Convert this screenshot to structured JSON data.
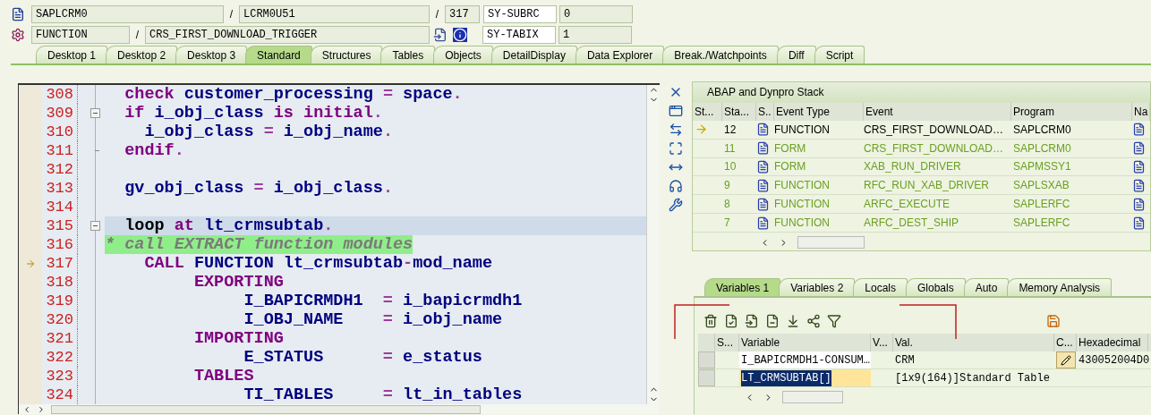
{
  "header": {
    "program": "SAPLCRM0",
    "include": "LCRM0U51",
    "line": "317",
    "event_type": "FUNCTION",
    "event": "CRS_FIRST_DOWNLOAD_TRIGGER",
    "separators": [
      "/",
      "/",
      "/"
    ],
    "system_fields": [
      {
        "name": "SY-SUBRC",
        "value": "0"
      },
      {
        "name": "SY-TABIX",
        "value": "1"
      }
    ]
  },
  "tabs": [
    {
      "label": "Desktop 1",
      "selected": false
    },
    {
      "label": "Desktop 2",
      "selected": false
    },
    {
      "label": "Desktop 3",
      "selected": false
    },
    {
      "label": "Standard",
      "selected": true
    },
    {
      "label": "Structures",
      "selected": false
    },
    {
      "label": "Tables",
      "selected": false
    },
    {
      "label": "Objects",
      "selected": false
    },
    {
      "label": "DetailDisplay",
      "selected": false
    },
    {
      "label": "Data Explorer",
      "selected": false
    },
    {
      "label": "Break./Watchpoints",
      "selected": false
    },
    {
      "label": "Diff",
      "selected": false
    },
    {
      "label": "Script",
      "selected": false
    }
  ],
  "editor": {
    "lines": [
      {
        "number": "308",
        "current": false,
        "highlighted": false,
        "foldable": false,
        "block_end": false,
        "tokens": [
          {
            "kind": "keyword",
            "text": "  check "
          },
          {
            "kind": "identifier",
            "text": "customer_processing "
          },
          {
            "kind": "operator",
            "text": "= "
          },
          {
            "kind": "identifier",
            "text": "space"
          },
          {
            "kind": "operator",
            "text": "."
          }
        ]
      },
      {
        "number": "309",
        "current": false,
        "highlighted": false,
        "foldable": true,
        "block_end": false,
        "tokens": [
          {
            "kind": "keyword",
            "text": "  if "
          },
          {
            "kind": "identifier",
            "text": "i_obj_class "
          },
          {
            "kind": "keyword",
            "text": "is initial"
          },
          {
            "kind": "operator",
            "text": "."
          }
        ]
      },
      {
        "number": "310",
        "current": false,
        "highlighted": false,
        "foldable": false,
        "block_end": false,
        "tokens": [
          {
            "kind": "identifier",
            "text": "    i_obj_class "
          },
          {
            "kind": "operator",
            "text": "= "
          },
          {
            "kind": "identifier",
            "text": "i_obj_name"
          },
          {
            "kind": "operator",
            "text": "."
          }
        ]
      },
      {
        "number": "311",
        "current": false,
        "highlighted": false,
        "foldable": false,
        "block_end": true,
        "tokens": [
          {
            "kind": "keyword",
            "text": "  endif"
          },
          {
            "kind": "operator",
            "text": "."
          }
        ]
      },
      {
        "number": "312",
        "current": false,
        "highlighted": false,
        "foldable": false,
        "block_end": false
      },
      {
        "number": "313",
        "current": false,
        "highlighted": false,
        "foldable": false,
        "block_end": false,
        "tokens": [
          {
            "kind": "identifier",
            "text": "  gv_obj_class "
          },
          {
            "kind": "operator",
            "text": "= "
          },
          {
            "kind": "identifier",
            "text": "i_obj_class"
          },
          {
            "kind": "operator",
            "text": "."
          }
        ]
      },
      {
        "number": "314",
        "current": false,
        "highlighted": false,
        "foldable": false,
        "block_end": false
      },
      {
        "number": "315",
        "current": false,
        "highlighted": true,
        "foldable": true,
        "block_end": false,
        "tokens": [
          {
            "kind": "plain",
            "text": "  loop "
          },
          {
            "kind": "keyword",
            "text": "at "
          },
          {
            "kind": "identifier",
            "text": "lt_crmsubtab"
          },
          {
            "kind": "operator",
            "text": "."
          }
        ]
      },
      {
        "number": "316",
        "current": false,
        "highlighted": false,
        "foldable": false,
        "block_end": false,
        "tokens": [
          {
            "kind": "comment",
            "text": "* call EXTRACT function modules"
          }
        ]
      },
      {
        "number": "317",
        "current": true,
        "highlighted": false,
        "foldable": false,
        "block_end": false,
        "tokens": [
          {
            "kind": "keyword",
            "text": "    CALL "
          },
          {
            "kind": "identifier",
            "text": "FUNCTION lt_crmsubtab"
          },
          {
            "kind": "operator",
            "text": "-"
          },
          {
            "kind": "identifier",
            "text": "mod_name"
          }
        ]
      },
      {
        "number": "318",
        "current": false,
        "highlighted": false,
        "foldable": false,
        "block_end": false,
        "tokens": [
          {
            "kind": "keyword",
            "text": "         EXPORTING"
          }
        ]
      },
      {
        "number": "319",
        "current": false,
        "highlighted": false,
        "foldable": false,
        "block_end": false,
        "tokens": [
          {
            "kind": "identifier",
            "text": "              I_BAPICRMDH1  "
          },
          {
            "kind": "operator",
            "text": "= "
          },
          {
            "kind": "identifier",
            "text": "i_bapicrmdh1"
          }
        ]
      },
      {
        "number": "320",
        "current": false,
        "highlighted": false,
        "foldable": false,
        "block_end": false,
        "tokens": [
          {
            "kind": "identifier",
            "text": "              I_OBJ_NAME    "
          },
          {
            "kind": "operator",
            "text": "= "
          },
          {
            "kind": "identifier",
            "text": "i_obj_name"
          }
        ]
      },
      {
        "number": "321",
        "current": false,
        "highlighted": false,
        "foldable": false,
        "block_end": false,
        "tokens": [
          {
            "kind": "keyword",
            "text": "         IMPORTING"
          }
        ]
      },
      {
        "number": "322",
        "current": false,
        "highlighted": false,
        "foldable": false,
        "block_end": false,
        "tokens": [
          {
            "kind": "identifier",
            "text": "              E_STATUS      "
          },
          {
            "kind": "operator",
            "text": "= "
          },
          {
            "kind": "identifier",
            "text": "e_status"
          }
        ]
      },
      {
        "number": "323",
        "current": false,
        "highlighted": false,
        "foldable": false,
        "block_end": false,
        "tokens": [
          {
            "kind": "keyword",
            "text": "         TABLES"
          }
        ]
      },
      {
        "number": "324",
        "current": false,
        "highlighted": false,
        "foldable": false,
        "block_end": false,
        "tokens": [
          {
            "kind": "identifier",
            "text": "              TI_TABLES     "
          },
          {
            "kind": "operator",
            "text": "= "
          },
          {
            "kind": "identifier",
            "text": "lt_in_tables"
          }
        ]
      }
    ]
  },
  "stack": {
    "title": "ABAP and Dynpro Stack",
    "columns": [
      "St...",
      "Sta...",
      "S..",
      "Event Type",
      "Event",
      "Program",
      "Na"
    ],
    "rows": [
      {
        "current": true,
        "number": "12",
        "event_type": "FUNCTION",
        "event": "CRS_FIRST_DOWNLOAD…",
        "program": "SAPLCRM0"
      },
      {
        "current": false,
        "number": "11",
        "event_type": "FORM",
        "event": "CRS_FIRST_DOWNLOAD…",
        "program": "SAPLCRM0"
      },
      {
        "current": false,
        "number": "10",
        "event_type": "FORM",
        "event": "XAB_RUN_DRIVER",
        "program": "SAPMSSY1"
      },
      {
        "current": false,
        "number": "9",
        "event_type": "FUNCTION",
        "event": "RFC_RUN_XAB_DRIVER",
        "program": "SAPLSXAB"
      },
      {
        "current": false,
        "number": "8",
        "event_type": "FUNCTION",
        "event": "ARFC_EXECUTE",
        "program": "SAPLERFC"
      },
      {
        "current": false,
        "number": "7",
        "event_type": "FUNCTION",
        "event": "ARFC_DEST_SHIP",
        "program": "SAPLERFC"
      }
    ]
  },
  "variable_tabs": [
    {
      "label": "Variables 1",
      "selected": true
    },
    {
      "label": "Variables 2",
      "selected": false
    },
    {
      "label": "Locals",
      "selected": false
    },
    {
      "label": "Globals",
      "selected": false
    },
    {
      "label": "Auto",
      "selected": false
    },
    {
      "label": "Memory Analysis",
      "selected": false
    }
  ],
  "variables": {
    "columns": [
      "S...",
      "Variable",
      "V...",
      "Val.",
      "C...",
      "Hexadecimal"
    ],
    "rows": [
      {
        "variable": "I_BAPICRMDH1-CONSUM…",
        "value": "CRM",
        "selected": false,
        "editable": true,
        "hex": "430052004D0"
      },
      {
        "variable": "LT_CRMSUBTAB[]",
        "value": "[1x9(164)]Standard Table",
        "selected": true,
        "editable": false
      }
    ]
  }
}
